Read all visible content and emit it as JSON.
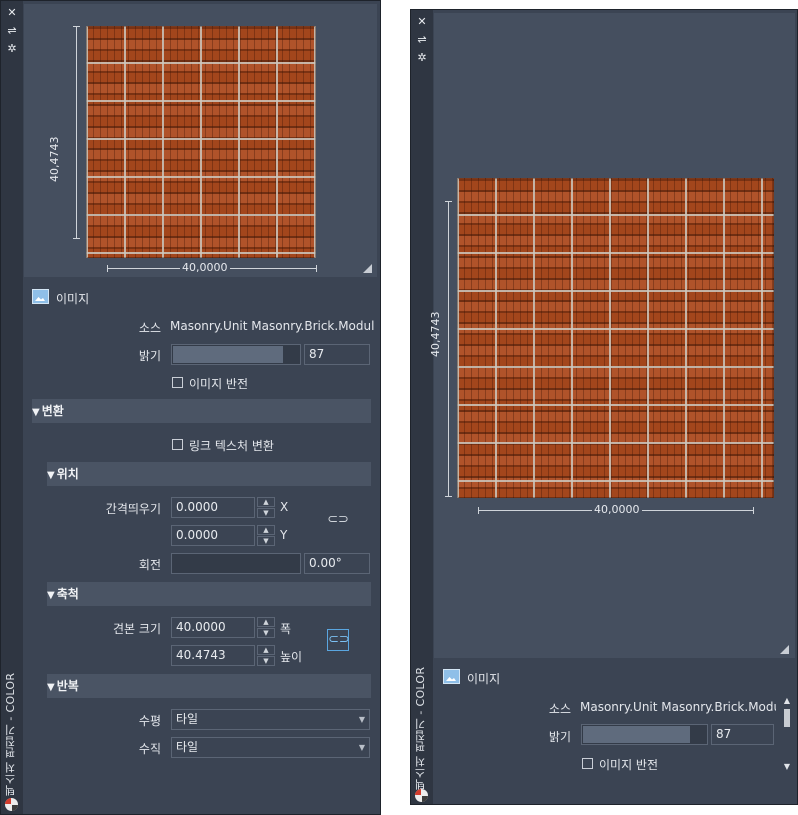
{
  "left_panel": {
    "vertical_title": "텍스처 편집기 - COLOR",
    "preview": {
      "height_dim": "40,4743",
      "width_dim": "40,0000"
    },
    "image_section": {
      "heading": "이미지",
      "source_label": "소스",
      "source_value": "Masonry.Unit Masonry.Brick.Modular.",
      "brightness_label": "밝기",
      "brightness_value": "87",
      "brightness_fraction": 0.87,
      "invert_label": "이미지 반전"
    },
    "transform": {
      "heading": "변환",
      "link_label": "링크 텍스처 변환",
      "position": {
        "heading": "위치",
        "offset_label": "간격띄우기",
        "offset_x": "0.0000",
        "offset_x_axis": "X",
        "offset_y": "0.0000",
        "offset_y_axis": "Y",
        "rotation_label": "회전",
        "rotation_value": "0.00°"
      },
      "scale": {
        "heading": "축척",
        "sample_label": "견본 크기",
        "width_value": "40.0000",
        "width_axis": "폭",
        "height_value": "40.4743",
        "height_axis": "높이"
      },
      "repeat": {
        "heading": "반복",
        "horizontal_label": "수평",
        "horizontal_value": "타일",
        "vertical_label": "수직",
        "vertical_value": "타일"
      }
    }
  },
  "right_panel": {
    "vertical_title": "텍스처 편집기 - COLOR",
    "preview": {
      "height_dim": "40,4743",
      "width_dim": "40,0000"
    },
    "image_section": {
      "heading": "이미지",
      "source_label": "소스",
      "source_value": "Masonry.Unit Masonry.Brick.Modula",
      "brightness_label": "밝기",
      "brightness_value": "87",
      "brightness_fraction": 0.87,
      "invert_label": "이미지 반전"
    }
  },
  "icons": {
    "close": "close-icon",
    "pin": "pin-icon",
    "settings": "gear-icon",
    "image": "image-icon",
    "link": "chain-link-icon"
  },
  "colors": {
    "panel_bg": "#3b4453",
    "accent": "#5aa6e0"
  }
}
